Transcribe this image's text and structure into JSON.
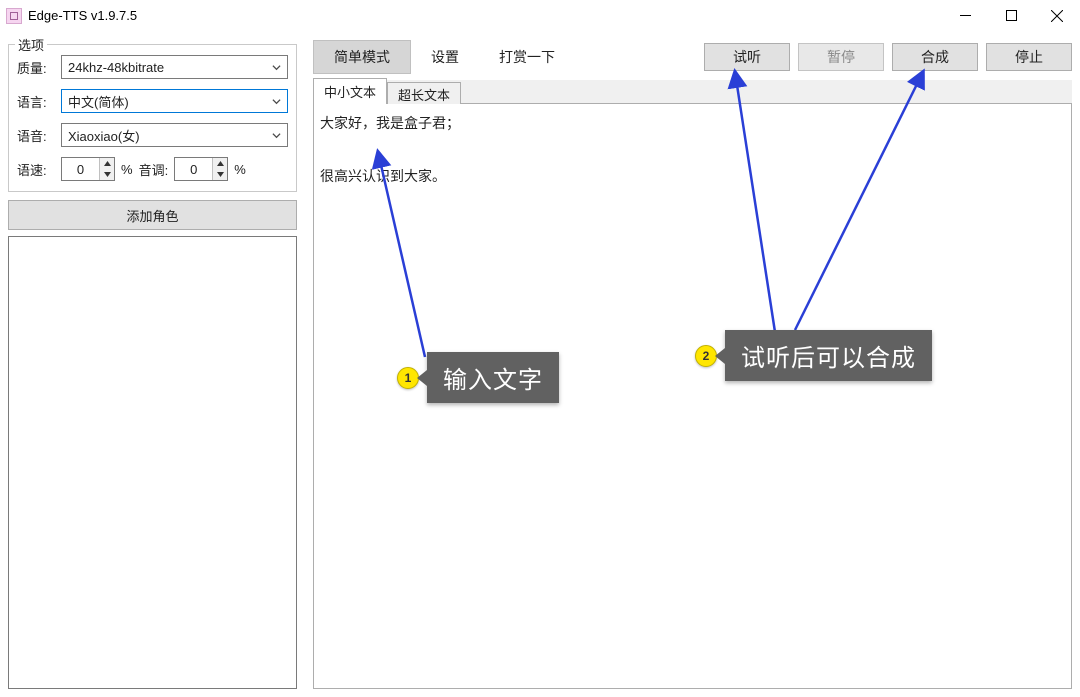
{
  "titlebar": {
    "title": "Edge-TTS v1.9.7.5"
  },
  "sidebar": {
    "group_title": "选项",
    "quality_label": "质量:",
    "quality_value": "24khz-48kbitrate",
    "language_label": "语言:",
    "language_value": "中文(简体)",
    "voice_label": "语音:",
    "voice_value": "Xiaoxiao(女)",
    "speed_label": "语速:",
    "speed_value": "0",
    "speed_suffix": "%",
    "pitch_label": "音调:",
    "pitch_value": "0",
    "pitch_suffix": "%",
    "add_role_label": "添加角色"
  },
  "main": {
    "tabs": {
      "simple": "简单模式",
      "settings": "设置",
      "donate": "打赏一下"
    },
    "buttons": {
      "preview": "试听",
      "pause": "暂停",
      "synthesize": "合成",
      "stop": "停止"
    },
    "sub_tabs": {
      "short": "中小文本",
      "long": "超长文本"
    },
    "text_content": "大家好，我是盒子君；\n\n很高兴认识到大家。"
  },
  "annotations": {
    "c1_num": "1",
    "c1_text": "输入文字",
    "c2_num": "2",
    "c2_text": "试听后可以合成"
  }
}
